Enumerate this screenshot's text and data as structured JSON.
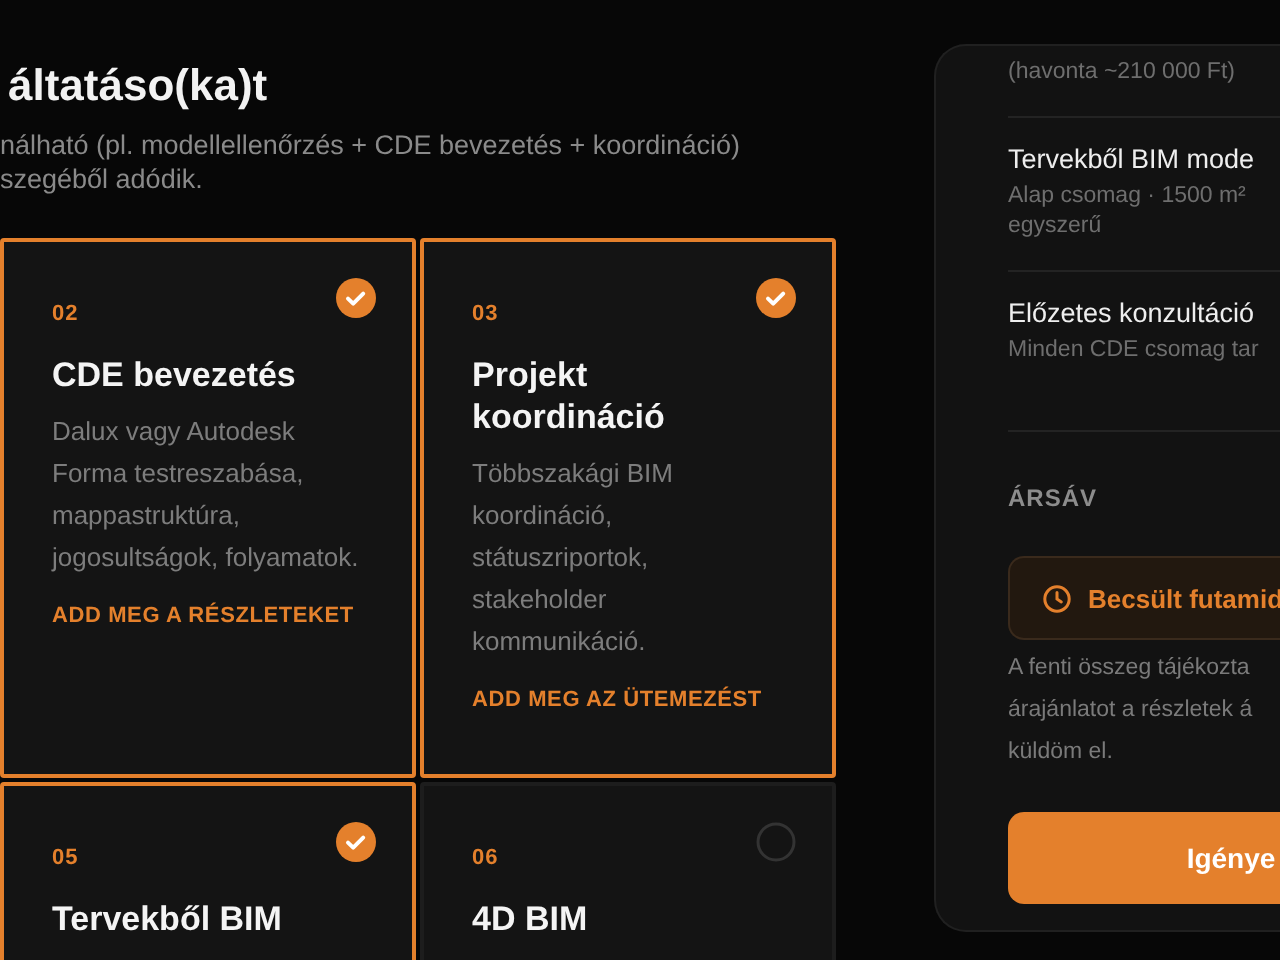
{
  "header": {
    "title": "áltatáso(ka)t",
    "subtitle_lines": [
      "nálható (pl. modellellenőrzés + CDE bevezetés + koordináció)",
      "szegéből adódik."
    ]
  },
  "services": [
    {
      "number": "02",
      "title": "CDE bevezetés",
      "description": "Dalux vagy Autodesk Forma testreszabása, mappastruktúra, jogosultságok, folyamatok.",
      "link": "ADD MEG A RÉSZLETEKET",
      "selected": true
    },
    {
      "number": "03",
      "title": "Projekt koordináció",
      "description": "Többszakági BIM koordináció, státuszriportok, stakeholder kommunikáció.",
      "link": "ADD MEG AZ ÜTEMEZÉST",
      "selected": true
    },
    {
      "number": "05",
      "title": "Tervekből BIM",
      "selected": true
    },
    {
      "number": "06",
      "title": "4D BIM",
      "selected": false
    }
  ],
  "summary": {
    "items": [
      {
        "detail_lines": [
          "(havonta ~210 000 Ft)"
        ]
      },
      {
        "name": "Tervekből BIM mode",
        "detail_lines": [
          "Alap csomag · 1500 m²",
          "egyszerű"
        ]
      },
      {
        "name": "Előzetes konzultáció",
        "detail_lines": [
          "Minden CDE csomag tar"
        ]
      }
    ],
    "price_range_label": "ÁRSÁV",
    "estimate": "Becsült futamid",
    "note_lines": [
      "A fenti összeg tájékozta",
      "árajánlatot a részletek á",
      "küldöm el."
    ],
    "button": "Igénye"
  }
}
